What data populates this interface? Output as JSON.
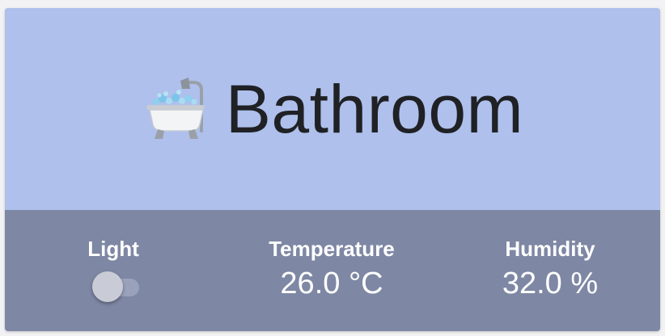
{
  "card": {
    "title": "Bathroom",
    "title_icon": "bathtub-icon",
    "colors": {
      "header_background": "#aec0eb",
      "footer_background": "#7e87a4",
      "title_text": "#1f2125",
      "footer_text": "#ffffff"
    }
  },
  "stats": {
    "light": {
      "label": "Light",
      "state": "off"
    },
    "temperature": {
      "label": "Temperature",
      "value": "26.0 °C"
    },
    "humidity": {
      "label": "Humidity",
      "value": "32.0 %"
    }
  }
}
